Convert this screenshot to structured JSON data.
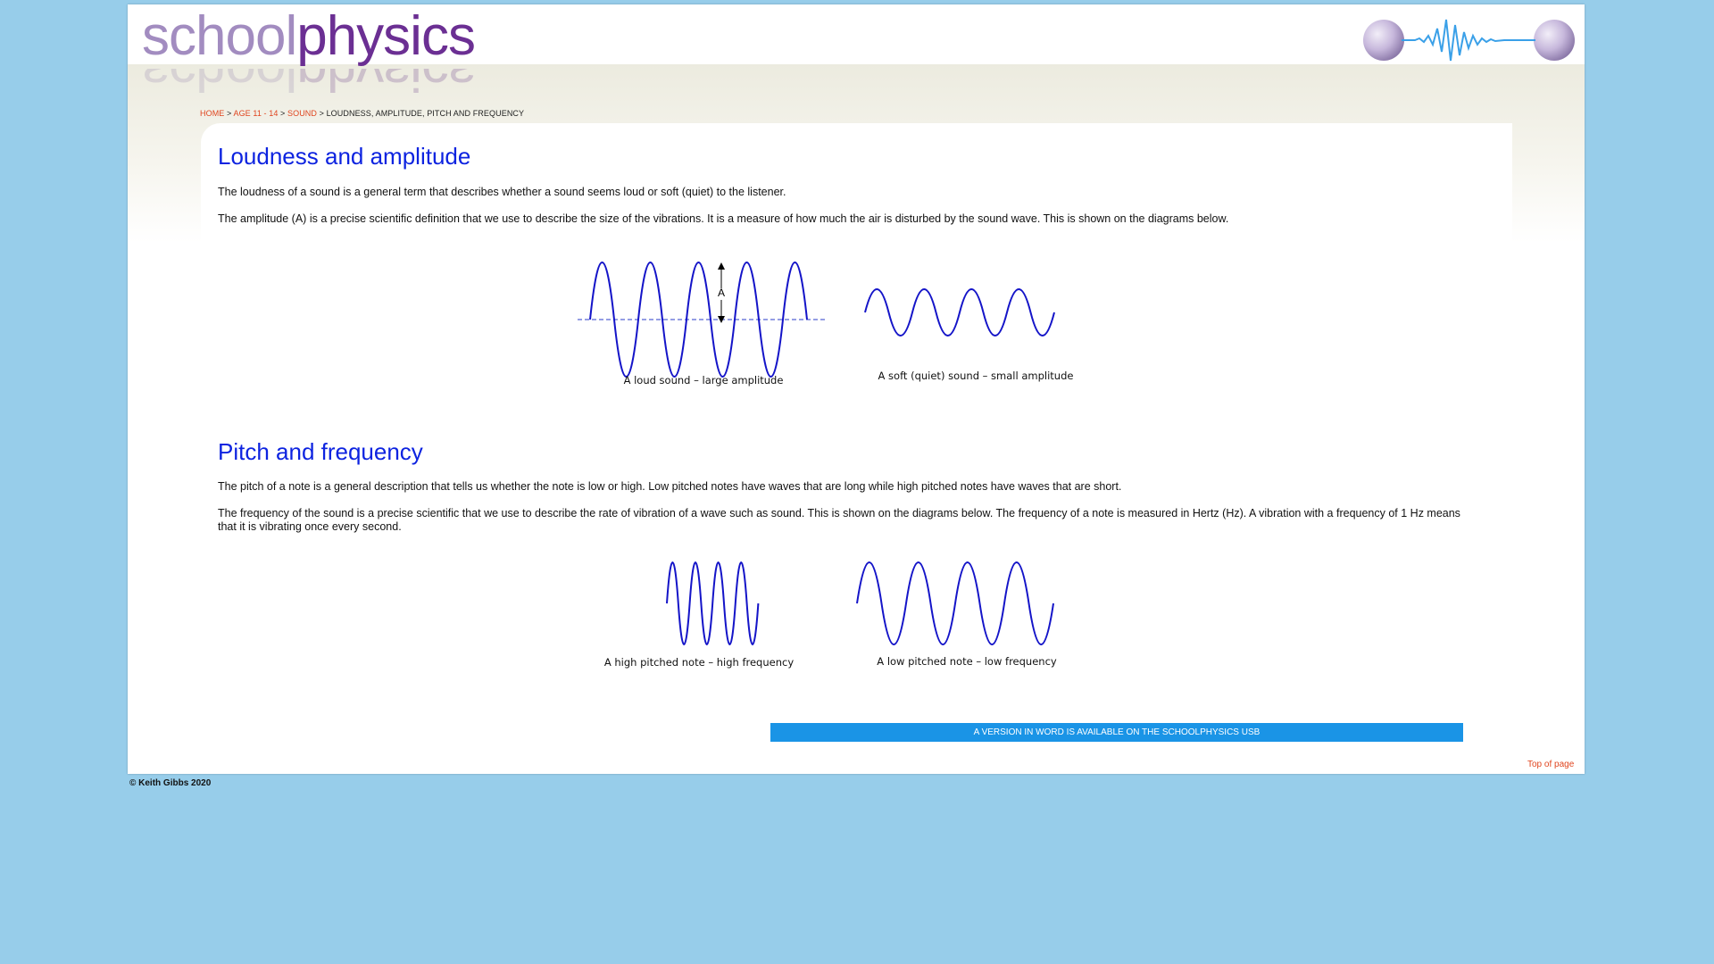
{
  "header": {
    "logo_part1": "school",
    "logo_part2": "physics"
  },
  "breadcrumb": {
    "home": "HOME",
    "sep1": " > ",
    "age": "AGE 11 - 14",
    "sep2": " > ",
    "sound": "SOUND",
    "sep3": " > ",
    "current": "LOUDNESS, AMPLITUDE, PITCH AND FREQUENCY"
  },
  "section1": {
    "title": "Loudness and amplitude",
    "para1": "The loudness of a sound is a general term that describes whether a sound seems loud or soft (quiet) to the listener.",
    "para2": "The amplitude (A) is a precise scientific definition that we use to describe the size of the vibrations. It is a measure of how much the air is disturbed by the sound wave. This is shown on the diagrams below.",
    "fig_loud_label": "A",
    "fig_loud_caption": "A loud sound – large amplitude",
    "fig_soft_caption": "A soft (quiet) sound – small amplitude"
  },
  "section2": {
    "title": "Pitch and frequency",
    "para1": "The pitch of a note is a general description that tells us whether the note is low or high. Low pitched notes have waves that are long while high pitched notes have waves that are short.",
    "para2": "The frequency of the sound is a precise scientific that we use to describe the rate of vibration of a wave such as sound. This is shown on the diagrams below. The frequency of a note is measured in Hertz (Hz). A vibration with a frequency of 1 Hz means that it is vibrating once every second.",
    "fig_high_caption": "A high pitched note – high frequency",
    "fig_low_caption": "A low pitched note – low frequency"
  },
  "banner": "A VERSION IN WORD IS AVAILABLE ON THE SCHOOLPHYSICS USB",
  "top_link": "Top of page",
  "footer": "© Keith Gibbs 2020",
  "colors": {
    "background": "#97cdea",
    "heading": "#0d23e0",
    "link": "#e0451f",
    "banner": "#1a94e6",
    "wave": "#1414c8"
  }
}
